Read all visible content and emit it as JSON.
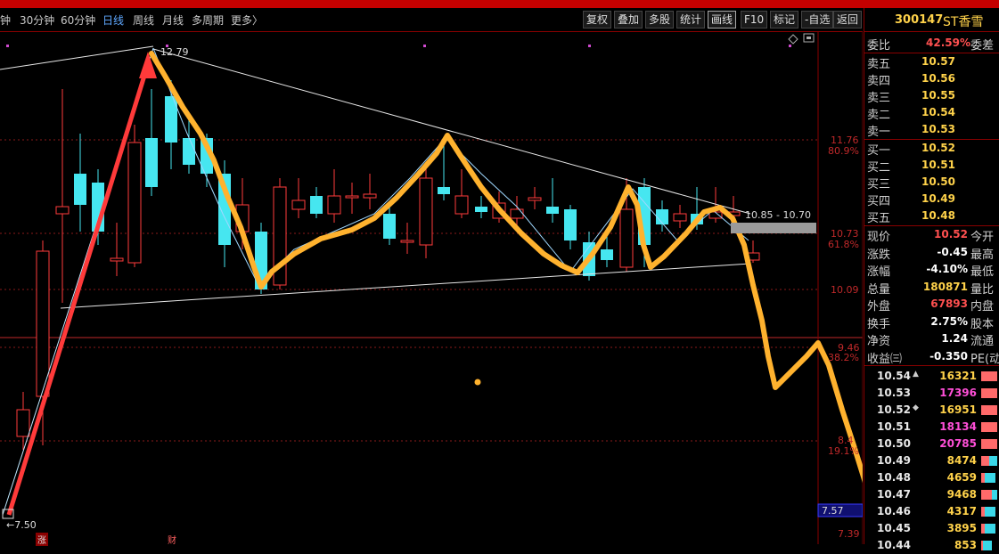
{
  "toolbar": {
    "periods": [
      {
        "label": "钟",
        "active": false
      },
      {
        "label": "30分钟",
        "active": false
      },
      {
        "label": "60分钟",
        "active": false
      },
      {
        "label": "日线",
        "active": true
      },
      {
        "label": "周线",
        "active": false
      },
      {
        "label": "月线",
        "active": false
      },
      {
        "label": "多周期",
        "active": false
      },
      {
        "label": "更多〉",
        "active": false
      }
    ],
    "buttons": [
      {
        "label": "复权",
        "active": false
      },
      {
        "label": "叠加",
        "active": false
      },
      {
        "label": "多股",
        "active": false
      },
      {
        "label": "统计",
        "active": false
      },
      {
        "label": "画线",
        "active": true
      },
      {
        "label": "F10",
        "active": false
      },
      {
        "label": "标记",
        "active": false
      },
      {
        "label": "-自选",
        "active": false
      },
      {
        "label": "返回",
        "active": false
      }
    ]
  },
  "chart": {
    "high_label": "12.79",
    "low_label": "←7.50",
    "range_label": "10.85 - 10.70",
    "price_axis": [
      {
        "price": "11.76",
        "pct": "80.9%"
      },
      {
        "price": "10.73",
        "pct": "61.8%"
      },
      {
        "price": "10.09",
        "pct": ""
      },
      {
        "price": "9.46",
        "pct": "38.2%"
      },
      {
        "price": "8.4",
        "pct": "19.1%"
      },
      {
        "price": "7.39",
        "pct": ""
      }
    ],
    "current_marker": "7.57",
    "event_badges": [
      "涨",
      "财"
    ],
    "colors": {
      "up": "#ff3b3b",
      "down": "#46e6f0",
      "overlay": "#ffb22e",
      "arrow": "#ff3a3a",
      "trend": "#e8e8e8"
    }
  },
  "stock": {
    "code": "300147",
    "name": "ST香雪"
  },
  "quote": {
    "weibi": {
      "label": "委比",
      "value": "42.59%",
      "label2": "委差"
    },
    "sells": [
      {
        "label": "卖五",
        "price": "10.57"
      },
      {
        "label": "卖四",
        "price": "10.56"
      },
      {
        "label": "卖三",
        "price": "10.55"
      },
      {
        "label": "卖二",
        "price": "10.54"
      },
      {
        "label": "卖一",
        "price": "10.53"
      }
    ],
    "buys": [
      {
        "label": "买一",
        "price": "10.52"
      },
      {
        "label": "买二",
        "price": "10.51"
      },
      {
        "label": "买三",
        "price": "10.50"
      },
      {
        "label": "买四",
        "price": "10.49"
      },
      {
        "label": "买五",
        "price": "10.48"
      }
    ],
    "stats": [
      {
        "label": "现价",
        "value": "10.52",
        "label2": "今开",
        "color": "#ff5050"
      },
      {
        "label": "涨跌",
        "value": "-0.45",
        "label2": "最高",
        "color": "#ffffff"
      },
      {
        "label": "涨幅",
        "value": "-4.10%",
        "label2": "最低",
        "color": "#ffffff"
      },
      {
        "label": "总量",
        "value": "180871",
        "label2": "量比",
        "color": "#ffd24a"
      },
      {
        "label": "外盘",
        "value": "67893",
        "label2": "内盘",
        "color": "#ff5050"
      },
      {
        "label": "换手",
        "value": "2.75%",
        "label2": "股本",
        "color": "#ffffff"
      },
      {
        "label": "净资",
        "value": "1.24",
        "label2": "流通",
        "color": "#ffffff"
      },
      {
        "label": "收益㈢",
        "value": "-0.350",
        "label2": "PE(动",
        "color": "#ffffff"
      }
    ],
    "ticks": [
      {
        "price": "10.54",
        "vol": "16321",
        "color": "#ffd24a",
        "arrow": "▲",
        "red": 0.9,
        "cyan": 0
      },
      {
        "price": "10.53",
        "vol": "17396",
        "color": "#ff4fd8",
        "arrow": "",
        "red": 0.9,
        "cyan": 0
      },
      {
        "price": "10.52",
        "vol": "16951",
        "color": "#ffd24a",
        "arrow": "◆",
        "red": 0.9,
        "cyan": 0
      },
      {
        "price": "10.51",
        "vol": "18134",
        "color": "#ff4fd8",
        "arrow": "",
        "red": 0.9,
        "cyan": 0
      },
      {
        "price": "10.50",
        "vol": "20785",
        "color": "#ff4fd8",
        "arrow": "",
        "red": 0.9,
        "cyan": 0
      },
      {
        "price": "10.49",
        "vol": "8474",
        "color": "#ffd24a",
        "arrow": "",
        "red": 0.45,
        "cyan": 0.45
      },
      {
        "price": "10.48",
        "vol": "4659",
        "color": "#ffd24a",
        "arrow": "",
        "red": 0.2,
        "cyan": 0.6
      },
      {
        "price": "10.47",
        "vol": "9468",
        "color": "#ffd24a",
        "arrow": "",
        "red": 0.6,
        "cyan": 0.3
      },
      {
        "price": "10.46",
        "vol": "4317",
        "color": "#ffd24a",
        "arrow": "",
        "red": 0.2,
        "cyan": 0.6
      },
      {
        "price": "10.45",
        "vol": "3895",
        "color": "#ffd24a",
        "arrow": "",
        "red": 0.2,
        "cyan": 0.6
      },
      {
        "price": "10.44",
        "vol": "853",
        "color": "#ffd24a",
        "arrow": "",
        "red": 0.1,
        "cyan": 0.5
      }
    ]
  }
}
